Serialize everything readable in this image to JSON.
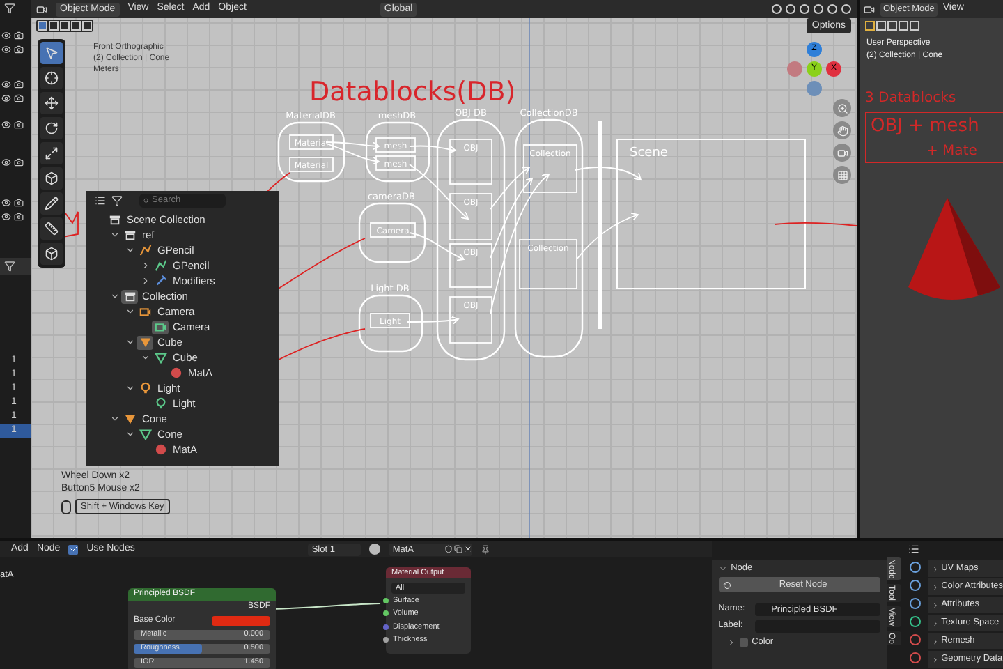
{
  "outliner_strip": {
    "rows": [
      {
        "text": "1",
        "selected": false
      },
      {
        "text": "1",
        "selected": false
      },
      {
        "text": "1",
        "selected": false
      },
      {
        "text": "1",
        "selected": false
      },
      {
        "text": "1",
        "selected": false
      },
      {
        "text": "1",
        "selected": true
      }
    ]
  },
  "viewport": {
    "header": {
      "mode": "Object Mode",
      "menus": [
        "View",
        "Select",
        "Add",
        "Object"
      ],
      "orientation": "Global",
      "options": "Options"
    },
    "info": [
      "Front Orthographic",
      "(2) Collection | Cone",
      "Meters"
    ],
    "axes": [
      {
        "label": "Z",
        "color": "#2f7fd8"
      },
      {
        "label": "Y",
        "color": "#8bd11a"
      },
      {
        "label": "X",
        "color": "#e0303f"
      }
    ],
    "tools": [
      {
        "kind": "select",
        "selected": true
      },
      {
        "kind": "cursor",
        "selected": false
      },
      {
        "kind": "move",
        "selected": false
      },
      {
        "kind": "rotate",
        "selected": false
      },
      {
        "kind": "scale",
        "selected": false
      },
      {
        "kind": "transform",
        "selected": false
      },
      {
        "kind": "annotate",
        "selected": false
      },
      {
        "kind": "measure",
        "selected": false
      },
      {
        "kind": "add-cube",
        "selected": false
      }
    ],
    "diagram": {
      "title": "Datablocks(DB)",
      "scene": "Scene",
      "groups": [
        {
          "label": "MaterialDB",
          "items": [
            "Material",
            "Material"
          ]
        },
        {
          "label": "meshDB",
          "items": [
            "mesh",
            "mesh"
          ]
        },
        {
          "label": "OBJ DB",
          "items": [
            "OBJ",
            "OBJ",
            "OBJ",
            "OBJ"
          ]
        },
        {
          "label": "CollectionDB",
          "items": [
            "Collection",
            "Collection"
          ]
        },
        {
          "label": "cameraDB",
          "items": [
            "Camera"
          ]
        },
        {
          "label": "Light DB",
          "items": [
            "Light"
          ]
        }
      ]
    },
    "outliner": {
      "search_placeholder": "Search",
      "tree": [
        {
          "label": "Scene Collection",
          "kind": "scene",
          "children": [
            {
              "label": "ref",
              "kind": "collection",
              "expanded": true,
              "children": [
                {
                  "label": "GPencil",
                  "kind": "gpencil-object",
                  "expanded": true,
                  "children": [
                    {
                      "label": "GPencil",
                      "kind": "gpencil-data",
                      "expanded": false
                    },
                    {
                      "label": "Modifiers",
                      "kind": "modifiers",
                      "expanded": false
                    }
                  ]
                }
              ]
            },
            {
              "label": "Collection",
              "kind": "collection",
              "expanded": true,
              "highlighted": true,
              "children": [
                {
                  "label": "Camera",
                  "kind": "camera-object",
                  "expanded": true,
                  "children": [
                    {
                      "label": "Camera",
                      "kind": "camera-data",
                      "highlighted": true
                    }
                  ]
                },
                {
                  "label": "Cube",
                  "kind": "mesh-object",
                  "expanded": true,
                  "highlighted": true,
                  "children": [
                    {
                      "label": "Cube",
                      "kind": "mesh-data",
                      "expanded": true,
                      "children": [
                        {
                          "label": "MatA",
                          "kind": "material"
                        }
                      ]
                    }
                  ]
                },
                {
                  "label": "Light",
                  "kind": "light-object",
                  "expanded": true,
                  "children": [
                    {
                      "label": "Light",
                      "kind": "light-data"
                    }
                  ]
                }
              ]
            },
            {
              "label": "Cone",
              "kind": "mesh-object",
              "expanded": true,
              "children": [
                {
                  "label": "Cone",
                  "kind": "mesh-data",
                  "expanded": true,
                  "children": [
                    {
                      "label": "MatA",
                      "kind": "material"
                    }
                  ]
                }
              ]
            }
          ]
        }
      ]
    },
    "screencast": {
      "lines": [
        "Wheel Down x2",
        "Button5 Mouse x2"
      ],
      "key": "Shift + Windows Key"
    }
  },
  "right_viewport": {
    "mode": "Object Mode",
    "menus": [
      "View"
    ],
    "info": [
      "User Perspective",
      "(2) Collection | Cone"
    ],
    "notes": [
      "3 Datablocks",
      "OBJ + mesh",
      "+ Mate"
    ]
  },
  "node_editor": {
    "menus": [
      "Add",
      "Node"
    ],
    "use_nodes": {
      "label": "Use Nodes",
      "checked": true
    },
    "slot": "Slot 1",
    "material": "MatA",
    "corner_label": "atA",
    "principled": {
      "title": "Principled BSDF",
      "output": "BSDF",
      "inputs": [
        {
          "label": "Base Color",
          "kind": "color",
          "color": "#e02a12"
        },
        {
          "label": "Metallic",
          "kind": "slider",
          "value": "0.000",
          "level": 0
        },
        {
          "label": "Roughness",
          "kind": "slider",
          "value": "0.500",
          "level": 0.5
        },
        {
          "label": "IOR",
          "kind": "number",
          "value": "1.450"
        }
      ]
    },
    "output": {
      "title": "Material Output",
      "target": "All",
      "inputs": [
        {
          "label": "Surface",
          "color": "#63c763"
        },
        {
          "label": "Volume",
          "color": "#63c763"
        },
        {
          "label": "Displacement",
          "color": "#6363c7"
        },
        {
          "label": "Thickness",
          "color": "#a1a1a1"
        }
      ]
    }
  },
  "sidebar": {
    "tabs": [
      {
        "label": "Node",
        "selected": true
      },
      {
        "label": "Tool",
        "selected": false
      },
      {
        "label": "View",
        "selected": false
      },
      {
        "label": "Op",
        "selected": false
      }
    ],
    "panel": "Node",
    "reset": "Reset Node",
    "name_label": "Name:",
    "name_value": "Principled BSDF",
    "label_label": "Label:",
    "color_label": "Color",
    "color_checked": false
  },
  "properties": {
    "items": [
      "UV Maps",
      "Color Attributes",
      "Attributes",
      "Texture Space",
      "Remesh",
      "Geometry Data"
    ]
  }
}
